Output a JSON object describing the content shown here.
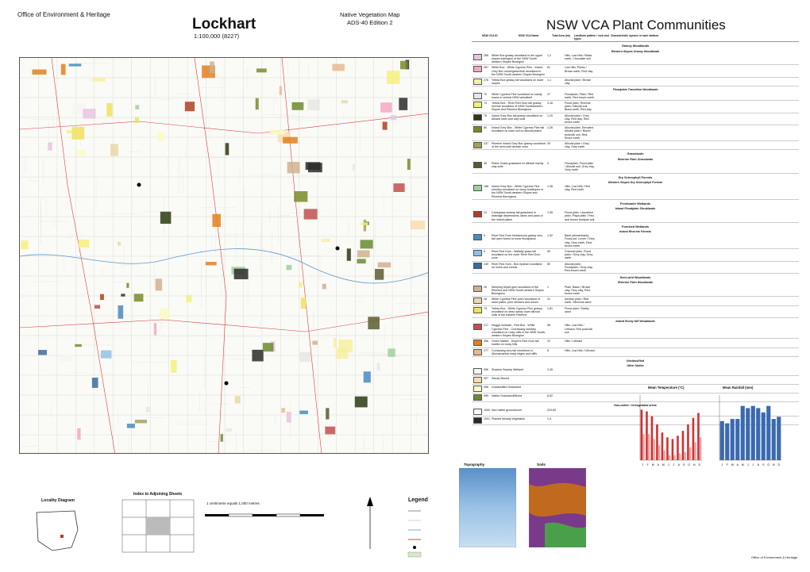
{
  "header": {
    "org": "Office of Environment & Heritage",
    "map_title": "Lockhart",
    "map_scale": "1:100,000 (8227)",
    "series_line1": "Native Vegetation Map",
    "series_line2": "ADS-40 Edition 2",
    "panel_title": "NSW VCA Plant Communities"
  },
  "legend_table": {
    "headers": [
      "NSW VCA ID",
      "NSW VCA Name",
      "Total Area (ha)",
      "Landform pattern / rock and types",
      "Characteristic species in each stratum"
    ],
    "groups": [
      {
        "title": "Grassy Woodlands",
        "classes": [
          {
            "title": "Western Slopes Grassy Woodlands",
            "rows": [
              {
                "id": "266",
                "name": "White Box grassy woodland in the upper slopes subregion of the NSW South western Slopes Bioregion",
                "area": "1,2",
                "landform": "Hills, Low hills / Black earth, Chocolate soil",
                "color": "#e8c4e0"
              },
              {
                "id": "267",
                "name": "White Box - White Cypress Pine - Inland Grey Box shrub/grass/forb woodland in the NSW South-western Slopes Bioregion",
                "area": "61",
                "landform": "Low hills, Plains / Brown earth, Red clay",
                "color": "#f4a6c4"
              },
              {
                "id": "276",
                "name": "Yellow Box grassy tall woodland on lower slopes",
                "area": "1,1",
                "landform": "Alluvial plain / Brown clay",
                "color": "#f6f0a0"
              }
            ]
          },
          {
            "title": "Floodplain Transition Woodlands",
            "rows": [
              {
                "id": "70",
                "name": "White Cypress Pine woodland on sandy loams in central NSW wheatbelt",
                "area": "27",
                "landform": "Floodplain, Plain / Red earth, Red brown earth",
                "color": "#e6e6e6"
              },
              {
                "id": "74",
                "name": "Yellow Box - River Red Gum tall grassy riverine woodland of NSW Southwestern Slopes and Riverina Bioregions",
                "area": "3,16",
                "landform": "Flood plain, Riverine plain / Alluvial soil, Black earth, Red clay",
                "color": "#f5f07a"
              },
              {
                "id": "76",
                "name": "Inland Grey Box tall grassy woodland on alluvial loam and clay soils",
                "area": "1,20",
                "landform": "Alluvial plain / Grey clay, Red clay, Red-brown earth",
                "color": "#2a3a10"
              },
              {
                "id": "80",
                "name": "Inland Grey Box - White Cypress Pine tall woodland on loam soil on alluvial plains",
                "area": "1,26",
                "landform": "Alluvial plain, Elevated alluvial plain / Brown podzolic soil, Red-brown earth",
                "color": "#7a8a2a"
              },
              {
                "id": "237",
                "name": "Riverine Inland Grey Box grassy woodland of the semi-arid climate zone",
                "area": "30",
                "landform": "Alluvial plain / Grey clay, Grey earth",
                "color": "#a0a060"
              }
            ]
          }
        ]
      },
      {
        "title": "Grasslands",
        "classes": [
          {
            "title": "Riverine Plain Grasslands",
            "rows": [
              {
                "id": "45",
                "name": "Plains Grass grassland on alluvial mainly clay soils",
                "area": "4",
                "landform": "Floodplain, Flood plain / Alluvial soil, Grey clay, Grey earth",
                "color": "#5a5a30"
              }
            ]
          }
        ]
      },
      {
        "title": "Dry Sclerophyll Forests",
        "classes": [
          {
            "title": "Western Slopes Dry Sclerophyll Forests",
            "rows": [
              {
                "id": "186",
                "name": "Inland Grey Box - White Cypress Pine shrubby woodland on stony footslopes in the NSW South-western Slopes and Riverina Bioregions",
                "area": "1,38",
                "landform": "Hills, Low hills / Red clay, Red earth",
                "color": "#9ed09e"
              }
            ]
          }
        ]
      },
      {
        "title": "Freshwater Wetlands",
        "classes": [
          {
            "title": "Inland Floodplain Shrublands",
            "rows": [
              {
                "id": "24",
                "name": "Canegrass swamp tall grassland in drainage depressions, lakes and pans of the inland plains",
                "area": "1,55",
                "landform": "Flood plain, Lacustrine plain, Playa plain / Red and brown hardpan soil",
                "color": "#b04020"
              }
            ]
          }
        ]
      },
      {
        "title": "Forested Wetlands",
        "classes": [
          {
            "title": "Inland Riverine Forests",
            "rows": [
              {
                "id": "5",
                "name": "River Red Gum herbaceous-grassy very tall open forest on inner floodplains",
                "area": "1,32",
                "landform": "Bank (streambank), Flood-out, Levee / Grey clay, Grey earth, Red-brown earth",
                "color": "#4a8ac0"
              },
              {
                "id": "9",
                "name": "River Red Gum - Wallaby grass tall woodland on the outer River Red Gum zone",
                "area": "90",
                "landform": "Channel plain, Flood plain / Grey clay, Grey earth",
                "color": "#90c0e8"
              },
              {
                "id": "249",
                "name": "River Red Gum - Box riparian woodland on rivers and creeks",
                "area": "80",
                "landform": "Alluvial plain, Floodplain / Grey clay, Red-brown earth",
                "color": "#3a6aa0"
              }
            ]
          }
        ]
      },
      {
        "title": "Semi-arid Woodlands",
        "classes": [
          {
            "title": "Riverine Plain Woodlands",
            "rows": [
              {
                "id": "26",
                "name": "Weeping Myall open woodland of the Riverina and NSW South-western Slopes Bioregions",
                "area": "1",
                "landform": "Plain, Basin / Brown clay, Grey clay, Red-brown earth",
                "color": "#d0b090"
              },
              {
                "id": "28",
                "name": "White Cypress Pine open woodland of sand plains, prior streams and dunes",
                "area": "21",
                "landform": "Aeolian plain / Red earth, Siliceous sand",
                "color": "#e8d8a8"
              },
              {
                "id": "75",
                "name": "Yellow Box - White Cypress Pine grassy woodland on deep sandy loam alluvial soils of the eastern Riverina",
                "area": "1,81",
                "landform": "Flood plain / Earthy sand",
                "color": "#f0e060"
              }
            ]
          },
          {
            "title": "Inland Rocky Hill Woodlands",
            "rows": [
              {
                "id": "217",
                "name": "Mugga Ironbark - Red Box - White Cypress Pine - Currawang shrubby woodland on rocky hills in the NSW South-western Slopes Bioregion",
                "area": "98",
                "landform": "Hills, Low hills / Lithosol, Red podzolic soil",
                "color": "#c05050"
              },
              {
                "id": "356",
                "name": "Green Mallee - Dwyer's Red Gum tall mallee on rocky hills",
                "area": "22",
                "landform": "Hills / Lithosol",
                "color": "#e08020"
              },
              {
                "id": "277",
                "name": "Currawang very tall shrubland or Allocasuarina rocky ridges and cliffs",
                "area": "8",
                "landform": "Hills, Low hills / Lithosol",
                "color": "#e8b890"
              }
            ]
          }
        ]
      },
      {
        "title": "Unclassified",
        "classes": [
          {
            "title": "Other Native",
            "rows": [
              {
                "id": "996",
                "name": "Shadow Swamp Wetland",
                "area": "2,45",
                "landform": "",
                "color": "#f5f5f5"
              },
              {
                "id": "997",
                "name": "Sandy Mound",
                "area": "",
                "landform": "",
                "color": "#f8dcb0"
              },
              {
                "id": "998",
                "name": "Unclassified Grassland",
                "area": "",
                "landform": "",
                "color": "#fafac0"
              },
              {
                "id": "999",
                "name": "Native Grassland/Mixed",
                "area": "6,52",
                "landform": "",
                "color": "#6a8a30"
              }
            ]
          },
          {
            "title": "Non-native / Unvegetated areas",
            "rows": [
              {
                "id": "1000",
                "name": "Non native groundcover",
                "area": "224,65",
                "landform": "",
                "color": "#ffffff"
              },
              {
                "id": "1001",
                "name": "Planted Woody Vegetation",
                "area": "1,4",
                "landform": "",
                "color": "#2a2a2a"
              }
            ]
          }
        ]
      }
    ]
  },
  "chart_data": [
    {
      "type": "bar",
      "title": "Mean Temperature (°C)",
      "categories": [
        "J",
        "F",
        "M",
        "A",
        "M",
        "J",
        "J",
        "A",
        "S",
        "O",
        "N",
        "D"
      ],
      "series": [
        {
          "values": [
            31,
            30,
            27,
            22,
            17,
            14,
            13,
            15,
            18,
            22,
            26,
            29
          ]
        },
        {
          "values": [
            16,
            16,
            13,
            9,
            6,
            3,
            3,
            4,
            5,
            8,
            11,
            14
          ]
        }
      ],
      "ylim": [
        0,
        40
      ]
    },
    {
      "type": "bar",
      "title": "Mean Rainfall (mm)",
      "categories": [
        "J",
        "F",
        "M",
        "A",
        "M",
        "J",
        "J",
        "A",
        "S",
        "O",
        "N",
        "D"
      ],
      "values": [
        36,
        34,
        38,
        38,
        50,
        48,
        50,
        48,
        44,
        50,
        38,
        40
      ],
      "ylim": [
        0,
        60
      ]
    }
  ],
  "bottom": {
    "locality_title": "Locality Diagram",
    "adjoining_title": "Index to Adjoining Sheets",
    "scale_text": "1 centimetre equals 1,000 metres",
    "legend_title": "Legend",
    "topography_title": "Topography",
    "soils_title": "Soils",
    "agency": "Office of Environment & Heritage"
  },
  "colors": {
    "map_bg": "#fafaf6",
    "grid_line": "#c8c8c8",
    "road": "#d84040",
    "water": "#5a9ad0"
  }
}
